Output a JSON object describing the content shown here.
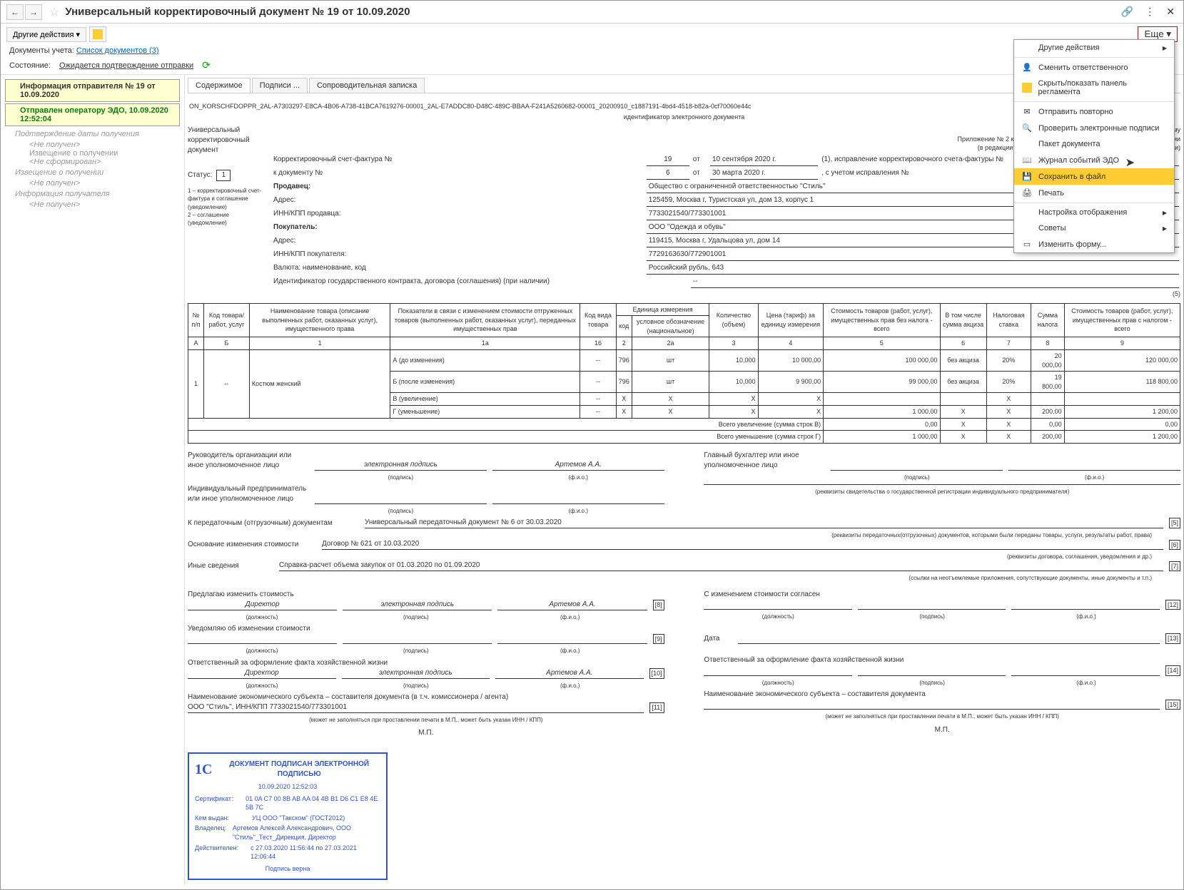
{
  "title": "Универсальный корректировочный документ № 19 от 10.09.2020",
  "toolbar": {
    "other_actions": "Другие действия ▾",
    "more": "Еще ▾"
  },
  "info": {
    "doc_acc_label": "Документы учета:",
    "doc_acc_link": "Список документов (3)",
    "state_label": "Состояние:",
    "state_text": "Ожидается подтверждение отправки"
  },
  "sidebar": {
    "info_sender": "Информация отправителя № 19 от 10.09.2020",
    "sent_op": "Отправлен оператору ЭДО, 10.09.2020 12:52:04",
    "confirm_date": "Подтверждение даты получения",
    "not_received": "<Не получен>",
    "notice_receipt": "Извещение о получении",
    "not_formed": "<Не сформирован>",
    "notice_receipt2": "Извещение о получении",
    "info_recipient": "Информация получателя"
  },
  "tabs": {
    "t1": "Содержимое",
    "t2": "Подписи ...",
    "t3": "Сопроводительная записка"
  },
  "doc": {
    "id_line": "ON_KORSCHFDOPPR_2AL-A7303297-E8CA-4B06-A738-41BCA7619276-00001_2AL-E7ADDC80-D48C-489C-BBAA-F241A5260682-00001_20200910_c1887191-4bd4-4518-b82a-0cf70060e44c",
    "id_label": "идентификатор электронного документа",
    "doc_type": "Универсальный корректировочный документ",
    "app_text": "Приложение № 1 к письму\nПриложение № 2 к постановлению Правительства Российской Федерации\n(в редакции постановления Правительства Российской Федерации)",
    "status_label": "Статус:",
    "status_val": "1",
    "status_note": "1 – корректировочный счет-фактура и соглашение (уведомление)\n2 – соглашение (уведомление)",
    "row1a": "Корректировочный счет-фактура №",
    "row1b": "19",
    "row1c": "от",
    "row1d": "10 сентября 2020 г.",
    "row1e": "(1), исправление корректировочного счета-фактуры №",
    "row1f": "от",
    "row2a": "к документу №",
    "row2b": "6",
    "row2c": "от",
    "row2d": "30 марта 2020 г.",
    "row2e": ", с учетом исправления №",
    "row2f": "от",
    "seller": "Продавец:",
    "seller_val": "Общество с ограниченной ответственностью \"Стиль\"",
    "addr": "Адрес:",
    "addr_val": "125459, Москва г, Туристская ул, дом 13, корпус 1",
    "inn_s": "ИНН/КПП продавца:",
    "inn_s_val": "7733021540/773301001",
    "buyer": "Покупатель:",
    "buyer_val": "ООО \"Одежда и обувь\"",
    "addr_b": "Адрес:",
    "addr_b_val": "119415, Москва г, Удальцова ул, дом 14",
    "inn_b": "ИНН/КПП покупателя:",
    "inn_b_val": "7729163630/772901001",
    "curr": "Валюта: наименование, код",
    "curr_val": "Российский рубль, 643",
    "contract": "Идентификатор государственного контракта, договора (соглашения) (при наличии)",
    "contract_val": "--",
    "note5": "(5)"
  },
  "table": {
    "headers": {
      "h1": "№ п/п",
      "h2": "Код товара/ работ, услуг",
      "h3": "Наименование товара (описание выполненных работ, оказанных услуг), имущественного права",
      "h4": "Показатели в связи с изменением стоимости отгруженных товаров (выполненных работ, оказанных услуг), переданных имущественных прав",
      "h5": "Код вида товара",
      "h6": "Единица измерения",
      "h6a": "код",
      "h6b": "условное обозначение (национальное)",
      "h7": "Количество (объем)",
      "h8": "Цена (тариф) за единицу измерения",
      "h9": "Стоимость товаров (работ, услуг), имущественных прав без налога - всего",
      "h10": "В том числе сумма акциза",
      "h11": "Налоговая ставка",
      "h12": "Сумма налога",
      "h13": "Стоимость товаров (работ, услуг), имущественных прав с налогом - всего",
      "nA": "А",
      "nB": "Б",
      "n1": "1",
      "n1a": "1а",
      "n16": "16",
      "n2": "2",
      "n2a": "2а",
      "n3": "3",
      "n4": "4",
      "n5": "5",
      "n6": "6",
      "n7": "7",
      "n8": "8",
      "n9": "9"
    },
    "rows": [
      {
        "n": "1",
        "code": "--",
        "name": "Костюм женский",
        "ind": "А (до изменения)",
        "kvt": "--",
        "ecode": "796",
        "eunit": "шт",
        "qty": "10,000",
        "price": "10 000,00",
        "cost": "100 000,00",
        "excise": "без акциза",
        "rate": "20%",
        "tax": "20 000,00",
        "total": "120 000,00"
      },
      {
        "n": "",
        "code": "",
        "name": "",
        "ind": "Б (после изменения)",
        "kvt": "--",
        "ecode": "796",
        "eunit": "шт",
        "qty": "10,000",
        "price": "9 900,00",
        "cost": "99 000,00",
        "excise": "без акциза",
        "rate": "20%",
        "tax": "19 800,00",
        "total": "118 800,00"
      },
      {
        "n": "",
        "code": "",
        "name": "",
        "ind": "В (увеличение)",
        "kvt": "--",
        "ecode": "Х",
        "eunit": "Х",
        "qty": "Х",
        "price": "Х",
        "cost": "",
        "excise": "",
        "rate": "Х",
        "tax": "",
        "total": ""
      },
      {
        "n": "",
        "code": "",
        "name": "",
        "ind": "Г (уменьшение)",
        "kvt": "--",
        "ecode": "Х",
        "eunit": "Х",
        "qty": "Х",
        "price": "Х",
        "cost": "1 000,00",
        "excise": "Х",
        "rate": "Х",
        "tax": "200,00",
        "total": "1 200,00"
      }
    ],
    "total_inc": "Всего увеличение (сумма строк В)",
    "ti_cost": "0,00",
    "ti_ex": "Х",
    "ti_rate": "Х",
    "ti_tax": "0,00",
    "ti_total": "0,00",
    "total_dec": "Всего уменьшение (сумма строк Г)",
    "td_cost": "1 000,00",
    "td_ex": "Х",
    "td_rate": "Х",
    "td_tax": "200,00",
    "td_total": "1 200,00"
  },
  "sig": {
    "head_org": "Руководитель организации или иное уполномоченное лицо",
    "esign": "электронная подпись",
    "fio": "Артемов А.А.",
    "chief_acc": "Главный бухгалтер или иное уполномоченное лицо",
    "ip": "Индивидуальный предприниматель или иное уполномоченное лицо",
    "podpis": "(подпись)",
    "fio_lbl": "(ф.и.о.)",
    "dolzh": "(должность)",
    "rekv_ip": "(реквизиты свидетельства о государственной регистрации индивидуального предпринимателя)",
    "transfer": "К передаточным (отгрузочным) документам",
    "transfer_val": "Универсальный передаточный документ № 6 от 30.03.2020",
    "transfer_note": "(реквизиты передаточных(отгрузочных) документов, которыми были переданы товары, услуги, результаты работ, права)",
    "basis": "Основание изменения стоимости",
    "basis_val": "Договор № 621 от 10.03.2020",
    "basis_note": "(реквизиты договора, соглашения, уведомления и др.)",
    "other": "Иные сведения",
    "other_val": "Справка-расчет объема закупок от 01.03.2020 по 01.09.2020",
    "other_note": "(ссылки на неотъемлемые приложения, сопутствующие документы, иные документы и т.п.)",
    "propose": "Предлагаю изменить стоимость",
    "agree": "С изменением стоимости согласен",
    "dir": "Директор",
    "notify": "Уведомляю об изменении стоимости",
    "date": "Дата",
    "resp": "Ответственный за оформление факта хозяйственной жизни",
    "econ": "Наименование экономического субъекта – составителя документа (в т.ч. комиссионера / агента)",
    "econ2": "Наименование экономического субъекта – составителя документа",
    "econ_val": "ООО \"Стиль\", ИНН/КПП 7733021540/773301001",
    "mp": "М.П.",
    "mp_note": "(может не заполняться при проставлении печати в М.П., может быть указан ИНН / КПП)",
    "n5": "[5]",
    "n6": "[6]",
    "n7": "[7]",
    "n8": "[8]",
    "n9": "[9]",
    "n10": "[10]",
    "n11": "[11]",
    "n12": "[12]",
    "n13": "[13]",
    "n14": "[14]",
    "n15": "[15]"
  },
  "stamp": {
    "title": "ДОКУМЕНТ ПОДПИСАН ЭЛЕКТРОННОЙ ПОДПИСЬЮ",
    "date": "10.09.2020 12:52:03",
    "cert_l": "Сертификат:",
    "cert": "01 0A C7 00 8B AB AA 04 4B B1 D6 C1 E8 4E 5B 7C",
    "issued_l": "Кем выдан:",
    "issued": "УЦ ООО \"Такском\" (ГОСТ2012)",
    "owner_l": "Владелец:",
    "owner": "Артемов Алексей Александрович, ООО \"Стиль\"_Тест_Дирекция, Директор",
    "valid_l": "Действителен:",
    "valid": "с 27.03.2020 11:56:44 по 27.03.2021 12:06:44",
    "verified": "Подпись верна"
  },
  "menu": {
    "m1": "Другие действия",
    "m2": "Сменить ответственного",
    "m3": "Скрыть/показать панель регламента",
    "m4": "Отправить повторно",
    "m5": "Проверить электронные подписи",
    "m6": "Пакет документа",
    "m7": "Журнал событий ЭДО",
    "m8": "Сохранить в файл",
    "m9": "Печать",
    "m10": "Настройка отображения",
    "m11": "Советы",
    "m12": "Изменить форму..."
  }
}
